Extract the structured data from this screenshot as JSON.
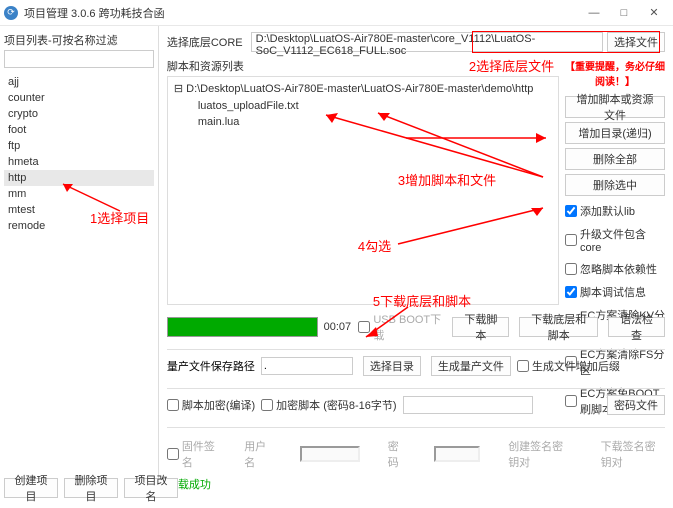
{
  "window": {
    "title": "项目管理 3.0.6 跨功耗技合函"
  },
  "left": {
    "header": "项目列表-可按名称过滤",
    "projects": [
      "ajj",
      "counter",
      "crypto",
      "foot",
      "ftp",
      "hmeta",
      "http",
      "mm",
      "mtest",
      "remode"
    ],
    "selected_index": 6,
    "footer_buttons": {
      "create": "创建项目",
      "delete": "删除项目",
      "rename": "项目改名"
    }
  },
  "annotations": {
    "a1": "1选择项目",
    "a2": "2选择底层文件",
    "a3": "3增加脚本和文件",
    "a4": "4勾选",
    "a5": "5下载底层和脚本"
  },
  "core": {
    "label": "选择底层CORE",
    "value": "D:\\Desktop\\LuatOS-Air780E-master\\core_V1112\\LuatOS-SoC_V1112_EC618_FULL.soc",
    "select_btn": "选择文件"
  },
  "scripts": {
    "header": "脚本和资源列表",
    "root": "D:\\Desktop\\LuatOS-Air780E-master\\LuatOS-Air780E-master\\demo\\http",
    "files": [
      "luatos_uploadFile.txt",
      "main.lua"
    ]
  },
  "right_buttons": {
    "important": "【重要提醒，务必仔细阅读！】",
    "add_script": "增加脚本或资源文件",
    "add_dir": "增加目录(递归)",
    "del_all": "删除全部",
    "del_sel": "删除选中"
  },
  "checks": {
    "default_lib": "添加默认lib",
    "upgrade_core": "升级文件包含core",
    "ignore_dep": "忽略脚本依赖性",
    "debug_info": "脚本调试信息",
    "ec_kv": "EC方案清除KV分区",
    "ec_fs": "EC方案清除FS分区",
    "ec_boot": "EC方案免BOOT刷脚本"
  },
  "status": {
    "time": "00:07",
    "usb_boot": "USB BOOT下载",
    "dl_script": "下载脚本",
    "dl_core_script": "下载底层和脚本",
    "syntax": "语法检查"
  },
  "mass": {
    "label": "量产文件保存路径",
    "path": ".",
    "select_dir": "选择目录",
    "gen_file": "生成量产文件",
    "gen_suffix": "生成文件增加后缀"
  },
  "encrypt": {
    "script_encrypt": "脚本加密(编译)",
    "encrypt_script": "加密脚本 (密码8-16字节)",
    "pwd_file": "密码文件"
  },
  "signature": {
    "firmware_sign": "固件签名",
    "user": "用户名",
    "pwd": "密码",
    "create_key": "创建签名密钥对",
    "dl_key": "下载签名密钥对"
  },
  "success": "下载成功"
}
